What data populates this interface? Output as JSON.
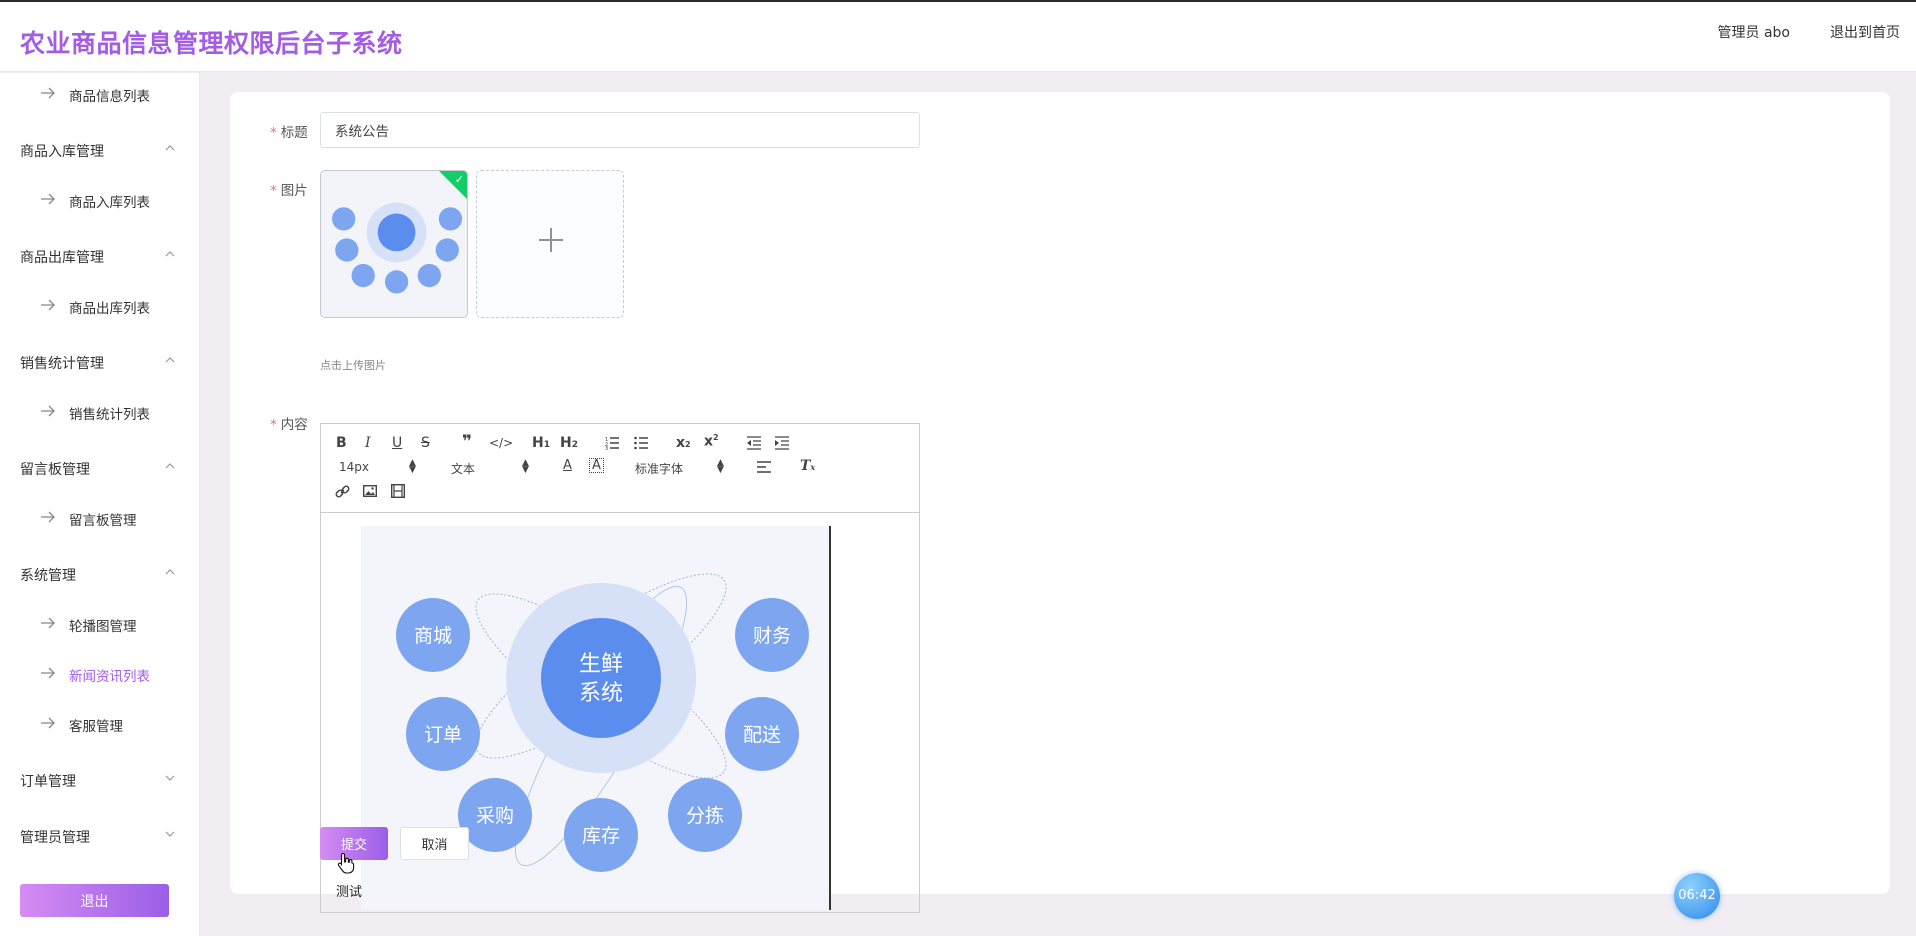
{
  "header": {
    "app_title": "农业商品信息管理权限后台子系统",
    "admin_label": "管理员 abo",
    "exit_home": "退出到首页"
  },
  "sidebar": {
    "items": [
      {
        "type": "item",
        "label": "商品信息列表"
      },
      {
        "type": "group",
        "label": "商品入库管理",
        "expanded": true
      },
      {
        "type": "item",
        "label": "商品入库列表"
      },
      {
        "type": "group",
        "label": "商品出库管理",
        "expanded": true
      },
      {
        "type": "item",
        "label": "商品出库列表"
      },
      {
        "type": "group",
        "label": "销售统计管理",
        "expanded": true
      },
      {
        "type": "item",
        "label": "销售统计列表"
      },
      {
        "type": "group",
        "label": "留言板管理",
        "expanded": true
      },
      {
        "type": "item",
        "label": "留言板管理"
      },
      {
        "type": "group",
        "label": "系统管理",
        "expanded": true
      },
      {
        "type": "item",
        "label": "轮播图管理"
      },
      {
        "type": "item",
        "label": "新闻资讯列表",
        "active": true
      },
      {
        "type": "item",
        "label": "客服管理"
      },
      {
        "type": "group",
        "label": "订单管理",
        "expanded": false
      },
      {
        "type": "group",
        "label": "管理员管理",
        "expanded": false
      }
    ],
    "logout_label": "退出"
  },
  "form": {
    "required_mark": "*",
    "title_label": "标题",
    "title_value": "系统公告",
    "image_label": "图片",
    "upload_hint": "点击上传图片",
    "content_label": "内容"
  },
  "editor": {
    "font_size": "14px",
    "paragraph": "文本",
    "font_family": "标准字体",
    "body_text": "测试",
    "image": {
      "center": "生鲜\n系统",
      "center_line1": "生鲜",
      "center_line2": "系统",
      "bubbles": [
        "商城",
        "财务",
        "订单",
        "配送",
        "采购",
        "库存",
        "分拣"
      ]
    }
  },
  "actions": {
    "submit_label": "提交",
    "cancel_label": "取消"
  },
  "timer": "06:42",
  "colors": {
    "accent": "#a25ce6",
    "bubble": "#7ea6f0",
    "bubble_center": "#5b8def",
    "success": "#13ce66"
  }
}
